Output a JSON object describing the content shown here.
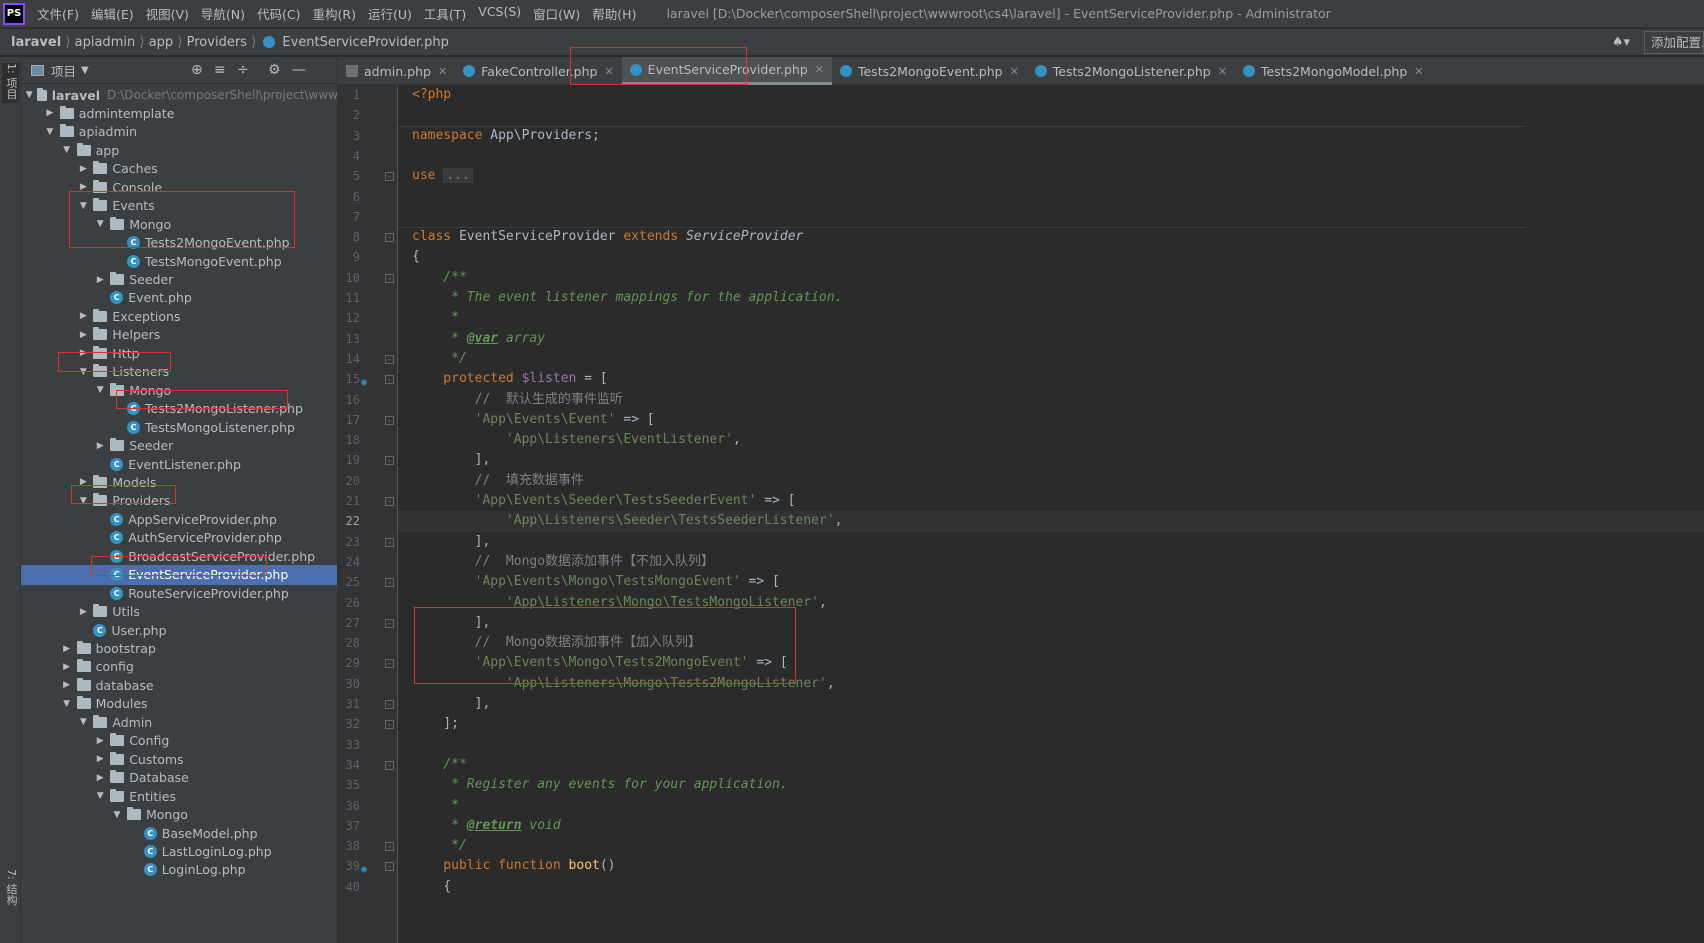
{
  "menubar": {
    "logo": "PS",
    "items": [
      "文件(F)",
      "编辑(E)",
      "视图(V)",
      "导航(N)",
      "代码(C)",
      "重构(R)",
      "运行(U)",
      "工具(T)",
      "VCS(S)",
      "窗口(W)",
      "帮助(H)"
    ],
    "window_title": "laravel [D:\\Docker\\composerShell\\project\\wwwroot\\cs4\\laravel] - EventServiceProvider.php - Administrator"
  },
  "breadcrumb": {
    "items": [
      "laravel",
      "apiadmin",
      "app",
      "Providers",
      "EventServiceProvider.php"
    ]
  },
  "toolbar": {
    "add_config_label": "添加配置...",
    "user_icon": "user-icon"
  },
  "left_strip": {
    "project_tab": "1: 项目",
    "structure_tab": "7: 结构"
  },
  "project_panel": {
    "title": "项目",
    "tree": [
      {
        "label": "laravel",
        "path": "D:\\Docker\\composerShell\\project\\www",
        "type": "folder",
        "depth": 0,
        "expanded": true,
        "bold": true
      },
      {
        "label": "admintemplate",
        "type": "folder",
        "depth": 1,
        "expanded": false
      },
      {
        "label": "apiadmin",
        "type": "folder",
        "depth": 1,
        "expanded": true
      },
      {
        "label": "app",
        "type": "folder",
        "depth": 2,
        "expanded": true
      },
      {
        "label": "Caches",
        "type": "folder",
        "depth": 3,
        "expanded": false
      },
      {
        "label": "Console",
        "type": "folder",
        "depth": 3,
        "expanded": false
      },
      {
        "label": "Events",
        "type": "folder",
        "depth": 3,
        "expanded": true
      },
      {
        "label": "Mongo",
        "type": "folder",
        "depth": 4,
        "expanded": true
      },
      {
        "label": "Tests2MongoEvent.php",
        "type": "php",
        "depth": 5
      },
      {
        "label": "TestsMongoEvent.php",
        "type": "php",
        "depth": 5
      },
      {
        "label": "Seeder",
        "type": "folder",
        "depth": 4,
        "expanded": false
      },
      {
        "label": "Event.php",
        "type": "php",
        "depth": 4
      },
      {
        "label": "Exceptions",
        "type": "folder",
        "depth": 3,
        "expanded": false
      },
      {
        "label": "Helpers",
        "type": "folder",
        "depth": 3,
        "expanded": false
      },
      {
        "label": "Http",
        "type": "folder",
        "depth": 3,
        "expanded": false
      },
      {
        "label": "Listeners",
        "type": "folder",
        "depth": 3,
        "expanded": true
      },
      {
        "label": "Mongo",
        "type": "folder",
        "depth": 4,
        "expanded": true
      },
      {
        "label": "Tests2MongoListener.php",
        "type": "php",
        "depth": 5
      },
      {
        "label": "TestsMongoListener.php",
        "type": "php",
        "depth": 5
      },
      {
        "label": "Seeder",
        "type": "folder",
        "depth": 4,
        "expanded": false
      },
      {
        "label": "EventListener.php",
        "type": "php",
        "depth": 4
      },
      {
        "label": "Models",
        "type": "folder",
        "depth": 3,
        "expanded": false
      },
      {
        "label": "Providers",
        "type": "folder",
        "depth": 3,
        "expanded": true
      },
      {
        "label": "AppServiceProvider.php",
        "type": "php",
        "depth": 4
      },
      {
        "label": "AuthServiceProvider.php",
        "type": "php",
        "depth": 4
      },
      {
        "label": "BroadcastServiceProvider.php",
        "type": "php",
        "depth": 4
      },
      {
        "label": "EventServiceProvider.php",
        "type": "php",
        "depth": 4,
        "selected": true
      },
      {
        "label": "RouteServiceProvider.php",
        "type": "php",
        "depth": 4
      },
      {
        "label": "Utils",
        "type": "folder",
        "depth": 3,
        "expanded": false
      },
      {
        "label": "User.php",
        "type": "php",
        "depth": 3
      },
      {
        "label": "bootstrap",
        "type": "folder",
        "depth": 2,
        "expanded": false
      },
      {
        "label": "config",
        "type": "folder",
        "depth": 2,
        "expanded": false
      },
      {
        "label": "database",
        "type": "folder",
        "depth": 2,
        "expanded": false
      },
      {
        "label": "Modules",
        "type": "folder",
        "depth": 2,
        "expanded": true
      },
      {
        "label": "Admin",
        "type": "folder",
        "depth": 3,
        "expanded": true
      },
      {
        "label": "Config",
        "type": "folder",
        "depth": 4,
        "expanded": false
      },
      {
        "label": "Customs",
        "type": "folder",
        "depth": 4,
        "expanded": false
      },
      {
        "label": "Database",
        "type": "folder",
        "depth": 4,
        "expanded": false
      },
      {
        "label": "Entities",
        "type": "folder",
        "depth": 4,
        "expanded": true
      },
      {
        "label": "Mongo",
        "type": "folder",
        "depth": 5,
        "expanded": true
      },
      {
        "label": "BaseModel.php",
        "type": "php",
        "depth": 6
      },
      {
        "label": "LastLoginLog.php",
        "type": "php",
        "depth": 6
      },
      {
        "label": "LoginLog.php",
        "type": "php",
        "depth": 6
      }
    ]
  },
  "tabs": [
    {
      "label": "admin.php",
      "icon": "php-file-icon",
      "active": false
    },
    {
      "label": "FakeController.php",
      "icon": "class-icon",
      "active": false
    },
    {
      "label": "EventServiceProvider.php",
      "icon": "class-icon",
      "active": true
    },
    {
      "label": "Tests2MongoEvent.php",
      "icon": "class-icon",
      "active": false
    },
    {
      "label": "Tests2MongoListener.php",
      "icon": "class-icon",
      "active": false
    },
    {
      "label": "Tests2MongoModel.php",
      "icon": "class-icon",
      "active": false
    }
  ],
  "editor": {
    "current_line": 22,
    "lines": [
      {
        "n": 1,
        "segs": [
          [
            "kw",
            "<?php"
          ]
        ]
      },
      {
        "n": 2,
        "segs": []
      },
      {
        "n": 3,
        "segs": [
          [
            "kw",
            "namespace "
          ],
          [
            "plain",
            "App\\Providers;"
          ]
        ]
      },
      {
        "n": 4,
        "segs": []
      },
      {
        "n": 5,
        "segs": [
          [
            "kw",
            "use "
          ],
          [
            "fold",
            "..."
          ]
        ]
      },
      {
        "n": 6,
        "segs": []
      },
      {
        "n": 7,
        "segs": []
      },
      {
        "n": 8,
        "segs": [
          [
            "kw",
            "class "
          ],
          [
            "plain",
            "EventServiceProvider "
          ],
          [
            "kw",
            "extends "
          ],
          [
            "cls-i",
            "ServiceProvider"
          ]
        ]
      },
      {
        "n": 9,
        "segs": [
          [
            "plain",
            "{"
          ]
        ]
      },
      {
        "n": 10,
        "segs": [
          [
            "doc",
            "    /**"
          ]
        ]
      },
      {
        "n": 11,
        "segs": [
          [
            "doc",
            "     * The event listener mappings for the application."
          ]
        ]
      },
      {
        "n": 12,
        "segs": [
          [
            "doc",
            "     *"
          ]
        ]
      },
      {
        "n": 13,
        "segs": [
          [
            "doc",
            "     * "
          ],
          [
            "doctag",
            "@var"
          ],
          [
            "doc-plain",
            " array"
          ]
        ]
      },
      {
        "n": 14,
        "segs": [
          [
            "doc",
            "     */"
          ]
        ]
      },
      {
        "n": 15,
        "segs": [
          [
            "kw",
            "    protected "
          ],
          [
            "var",
            "$listen"
          ],
          [
            "plain",
            " = ["
          ]
        ]
      },
      {
        "n": 16,
        "segs": [
          [
            "cmt",
            "        //  默认生成的事件监听"
          ]
        ]
      },
      {
        "n": 17,
        "segs": [
          [
            "str",
            "        'App\\Events\\Event'"
          ],
          [
            "plain",
            " => ["
          ]
        ]
      },
      {
        "n": 18,
        "segs": [
          [
            "str",
            "            'App\\Listeners\\EventListener'"
          ],
          [
            "plain",
            ","
          ]
        ]
      },
      {
        "n": 19,
        "segs": [
          [
            "plain",
            "        ],"
          ]
        ]
      },
      {
        "n": 20,
        "segs": [
          [
            "cmt",
            "        //  填充数据事件"
          ]
        ]
      },
      {
        "n": 21,
        "segs": [
          [
            "str",
            "        'App\\Events\\Seeder\\TestsSeederEvent'"
          ],
          [
            "plain",
            " => ["
          ]
        ]
      },
      {
        "n": 22,
        "segs": [
          [
            "str",
            "            'App\\Listeners\\Seeder\\TestsSeederListener'"
          ],
          [
            "plain",
            ","
          ]
        ]
      },
      {
        "n": 23,
        "segs": [
          [
            "plain",
            "        ],"
          ]
        ]
      },
      {
        "n": 24,
        "segs": [
          [
            "cmt",
            "        //  Mongo数据添加事件【不加入队列】"
          ]
        ]
      },
      {
        "n": 25,
        "segs": [
          [
            "str",
            "        'App\\Events\\Mongo\\TestsMongoEvent'"
          ],
          [
            "plain",
            " => ["
          ]
        ]
      },
      {
        "n": 26,
        "segs": [
          [
            "str",
            "            'App\\Listeners\\Mongo\\TestsMongoListener'"
          ],
          [
            "plain",
            ","
          ]
        ]
      },
      {
        "n": 27,
        "segs": [
          [
            "plain",
            "        ],"
          ]
        ]
      },
      {
        "n": 28,
        "segs": [
          [
            "cmt",
            "        //  Mongo数据添加事件【加入队列】"
          ]
        ]
      },
      {
        "n": 29,
        "segs": [
          [
            "str",
            "        'App\\Events\\Mongo\\Tests2MongoEvent'"
          ],
          [
            "plain",
            " => ["
          ]
        ]
      },
      {
        "n": 30,
        "segs": [
          [
            "str",
            "            'App\\Listeners\\Mongo\\Tests2MongoListener'"
          ],
          [
            "plain",
            ","
          ]
        ]
      },
      {
        "n": 31,
        "segs": [
          [
            "plain",
            "        ],"
          ]
        ]
      },
      {
        "n": 32,
        "segs": [
          [
            "plain",
            "    ];"
          ]
        ]
      },
      {
        "n": 33,
        "segs": []
      },
      {
        "n": 34,
        "segs": [
          [
            "doc",
            "    /**"
          ]
        ]
      },
      {
        "n": 35,
        "segs": [
          [
            "doc",
            "     * Register any events for your application."
          ]
        ]
      },
      {
        "n": 36,
        "segs": [
          [
            "doc",
            "     *"
          ]
        ]
      },
      {
        "n": 37,
        "segs": [
          [
            "doc",
            "     * "
          ],
          [
            "doctag",
            "@return"
          ],
          [
            "doc-plain",
            " void"
          ]
        ]
      },
      {
        "n": 38,
        "segs": [
          [
            "doc",
            "     */"
          ]
        ]
      },
      {
        "n": 39,
        "segs": [
          [
            "kw",
            "    public function "
          ],
          [
            "fn",
            "boot"
          ],
          [
            "plain",
            "()"
          ]
        ]
      },
      {
        "n": 40,
        "segs": [
          [
            "plain",
            "    {"
          ]
        ]
      }
    ]
  },
  "colors": {
    "annotation_box": "#e0302a",
    "selection": "#4b6eaf",
    "keyword": "#cc7832",
    "string": "#6a8759"
  }
}
